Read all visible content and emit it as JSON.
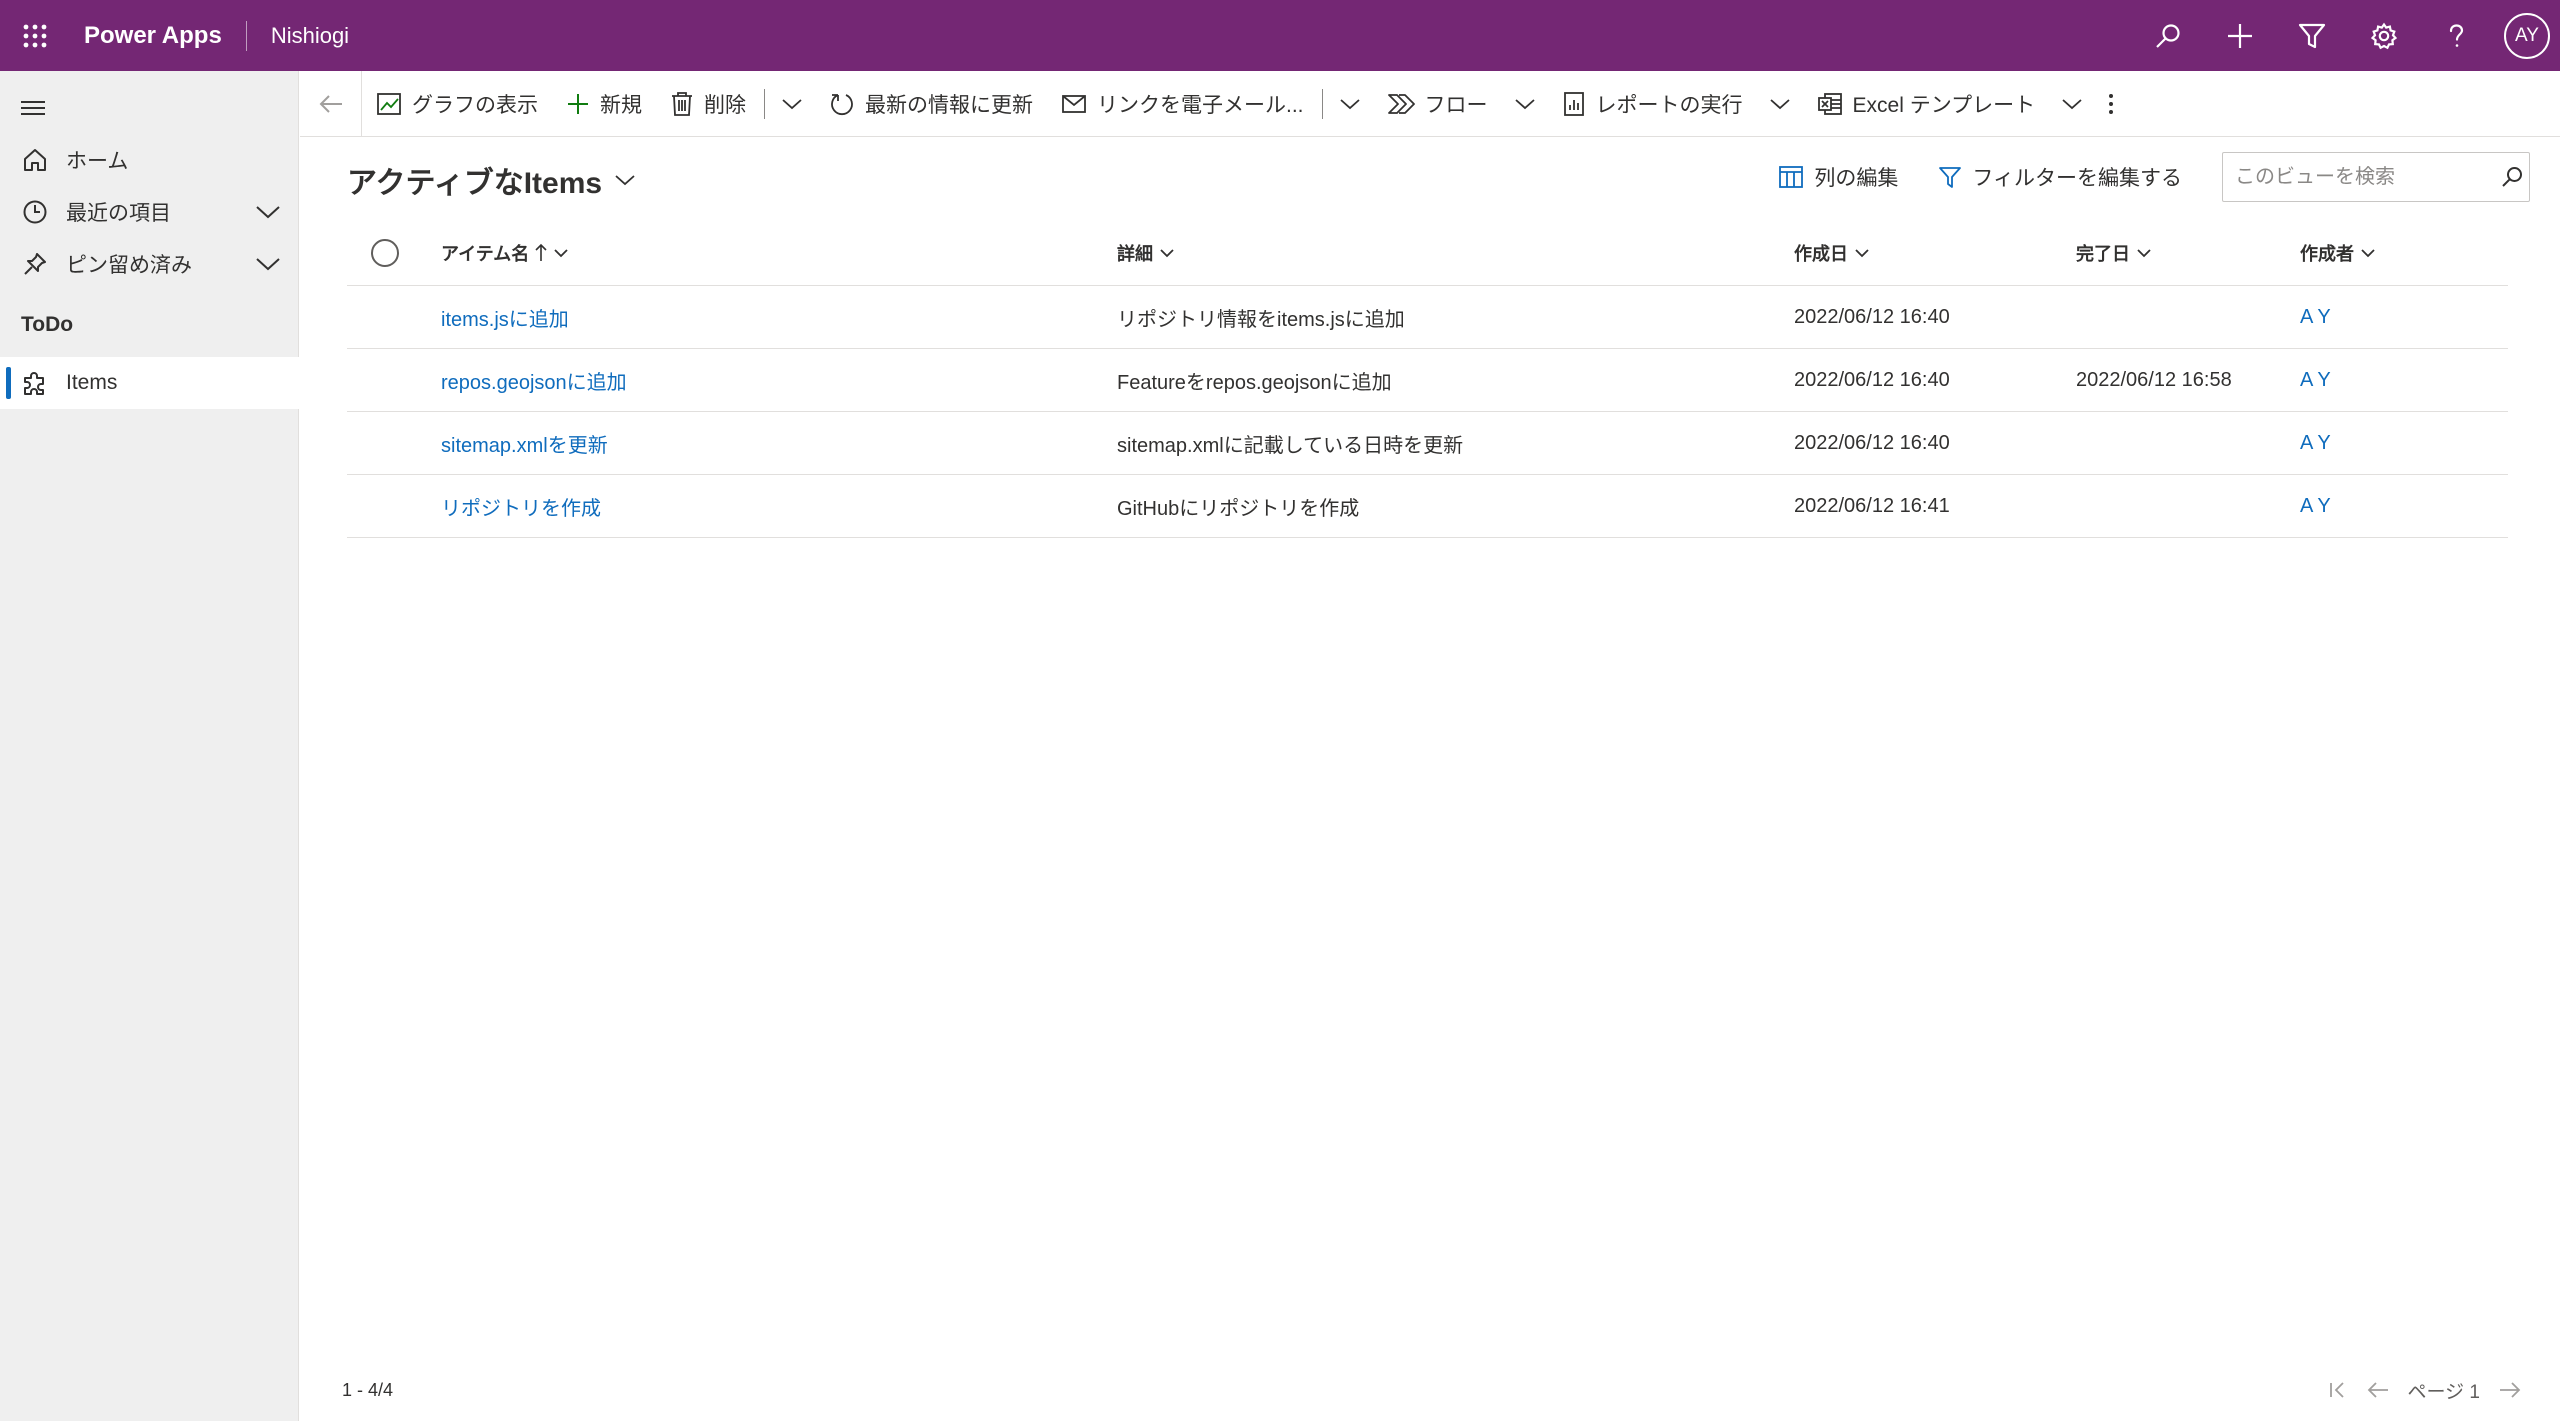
{
  "appbar": {
    "app_name": "Power Apps",
    "environment": "Nishiogi",
    "avatar_initials": "AY",
    "background": "#742774"
  },
  "nav": {
    "home": "ホーム",
    "recent": "最近の項目",
    "pinned": "ピン留め済み",
    "group": "ToDo",
    "items": "Items"
  },
  "commands": {
    "show_chart": "グラフの表示",
    "new": "新規",
    "delete": "削除",
    "refresh": "最新の情報に更新",
    "email_link": "リンクを電子メール...",
    "flow": "フロー",
    "run_report": "レポートの実行",
    "excel_template": "Excel テンプレート"
  },
  "view": {
    "title": "アクティブなItems",
    "edit_columns": "列の編集",
    "edit_filters": "フィルターを編集する",
    "search_placeholder": "このビューを検索"
  },
  "grid": {
    "columns": {
      "name": "アイテム名",
      "detail": "詳細",
      "created": "作成日",
      "completed": "完了日",
      "owner": "作成者"
    },
    "rows": [
      {
        "name": "items.jsに追加",
        "detail": "リポジトリ情報をitems.jsに追加",
        "created": "2022/06/12 16:40",
        "completed": "",
        "owner": "A Y"
      },
      {
        "name": "repos.geojsonに追加",
        "detail": "Featureをrepos.geojsonに追加",
        "created": "2022/06/12 16:40",
        "completed": "2022/06/12 16:58",
        "owner": "A Y"
      },
      {
        "name": "sitemap.xmlを更新",
        "detail": "sitemap.xmlに記載している日時を更新",
        "created": "2022/06/12 16:40",
        "completed": "",
        "owner": "A Y"
      },
      {
        "name": "リポジトリを作成",
        "detail": "GitHubにリポジトリを作成",
        "created": "2022/06/12 16:41",
        "completed": "",
        "owner": "A Y"
      }
    ]
  },
  "footer": {
    "record_count": "1 - 4/4",
    "page_label": "ページ 1"
  },
  "colors": {
    "accent": "#742774",
    "link": "#0f6cbd"
  }
}
